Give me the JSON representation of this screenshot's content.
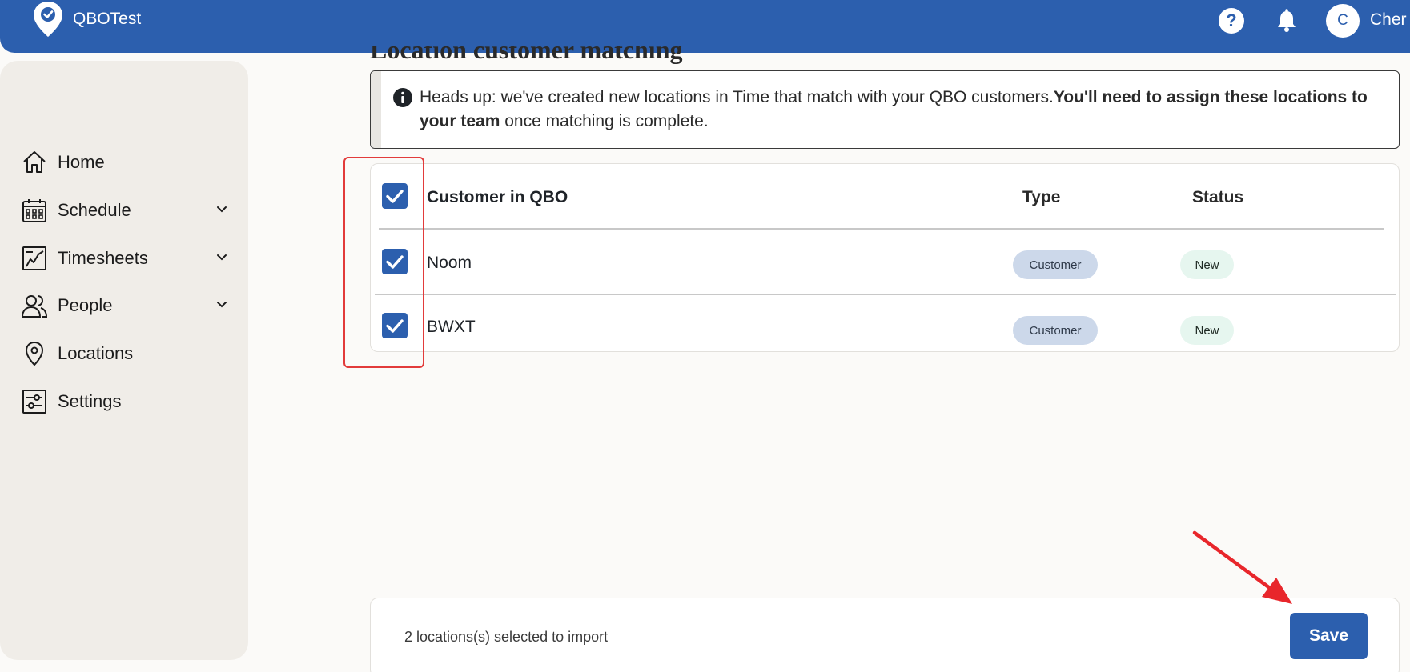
{
  "header": {
    "app_name": "QBOTest",
    "user_initial": "C",
    "user_name": "Cher"
  },
  "sidebar": {
    "items": [
      {
        "label": "Home",
        "icon": "home-icon",
        "has_chevron": false
      },
      {
        "label": "Schedule",
        "icon": "calendar-icon",
        "has_chevron": true
      },
      {
        "label": "Timesheets",
        "icon": "timesheet-icon",
        "has_chevron": true
      },
      {
        "label": "People",
        "icon": "people-icon",
        "has_chevron": true
      },
      {
        "label": "Locations",
        "icon": "location-pin-icon",
        "has_chevron": false
      },
      {
        "label": "Settings",
        "icon": "settings-icon",
        "has_chevron": false
      }
    ]
  },
  "main": {
    "title": "Location customer matching",
    "alert": {
      "text_plain": "Heads up: we've created new locations in Time that match with your QBO customers.",
      "text_bold": "You'll need to assign these locations to your team",
      "text_tail": " once matching is complete."
    },
    "table": {
      "columns": [
        "Customer in QBO",
        "Type",
        "Status"
      ],
      "header_checked": true,
      "rows": [
        {
          "name": "Noom",
          "type": "Customer",
          "status": "New",
          "checked": true
        },
        {
          "name": "BWXT",
          "type": "Customer",
          "status": "New",
          "checked": true
        }
      ]
    },
    "footer": {
      "selection_text": "2 locations(s) selected to import",
      "save_label": "Save"
    }
  },
  "colors": {
    "brand": "#2c5fae",
    "annotation": "#e23b3b",
    "sidebar_bg": "#f0ede8",
    "type_badge_bg": "#ccd8ea",
    "status_badge_bg": "#e6f6ef"
  }
}
